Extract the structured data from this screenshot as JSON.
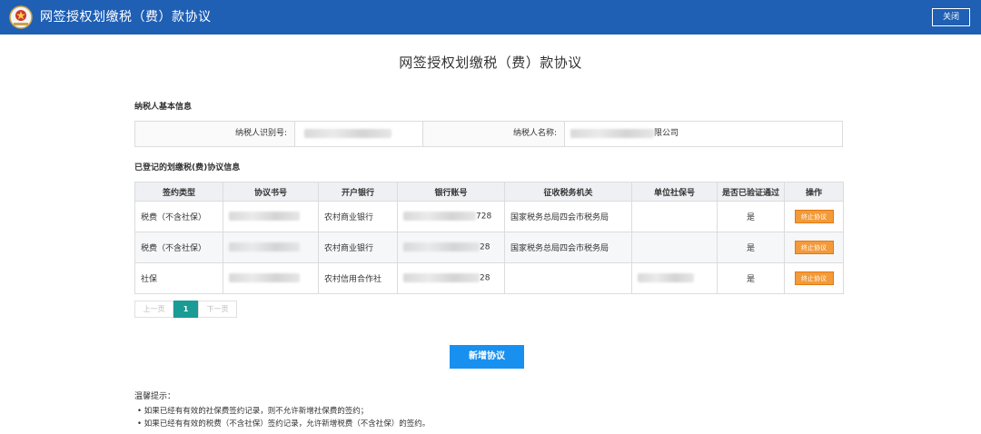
{
  "header": {
    "app_title": "网签授权划缴税（费）款协议",
    "close_label": "关闭",
    "brand_color": "#1f5fb4"
  },
  "page_title": "网签授权划缴税（费）款协议",
  "taxpayer": {
    "section_title": "纳税人基本信息",
    "id_label": "纳税人识别号:",
    "name_label": "纳税人名称:",
    "name_suffix": "限公司"
  },
  "agreements": {
    "section_title": "已登记的划缴税(费)协议信息",
    "columns": [
      "签约类型",
      "协议书号",
      "开户银行",
      "银行账号",
      "征收税务机关",
      "单位社保号",
      "是否已验证通过",
      "操作"
    ],
    "rows": [
      {
        "type": "税费（不含社保）",
        "bank": "农村商业银行",
        "account_suffix": "728",
        "authority": "国家税务总局四会市税务局",
        "verified": "是",
        "action": "终止协议"
      },
      {
        "type": "税费（不含社保）",
        "bank": "农村商业银行",
        "account_suffix": "28",
        "authority": "国家税务总局四会市税务局",
        "verified": "是",
        "action": "终止协议"
      },
      {
        "type": "社保",
        "bank": "农村信用合作社",
        "account_suffix": "28",
        "authority": "",
        "verified": "是",
        "action": "终止协议"
      }
    ]
  },
  "pager": {
    "prev": "上一页",
    "current": "1",
    "next": "下一页"
  },
  "add_button": "新增协议",
  "tips": {
    "title": "温馨提示：",
    "items": [
      "•  如果已经有有效的社保费签约记录，则不允许新增社保费的签约；",
      "•  如果已经有有效的税费（不含社保）签约记录，允许新增税费（不含社保）的签约。"
    ]
  },
  "icons": {
    "logo": "tax-emblem-icon"
  }
}
